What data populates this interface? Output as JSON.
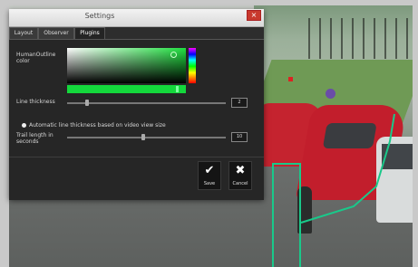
{
  "dialog": {
    "title": "Settings",
    "close_label": "×",
    "tabs": [
      {
        "label": "Layout"
      },
      {
        "label": "Observer"
      },
      {
        "label": "Plugins"
      }
    ]
  },
  "plugins": {
    "highlight_color_label": "HumanOutline color",
    "color_value": "#1fe03f",
    "line_thickness_label": "Line thickness",
    "line_thickness_value": "2",
    "auto_thickness_label": "Automatic line thickness based on video view size",
    "fade_length_label": "Trail length in seconds",
    "fade_length_value": "10",
    "save_label": "Save",
    "cancel_label": "Cancel"
  },
  "colors": {
    "accent_green": "#1fe03f",
    "zone_line": "#19c98a",
    "dialog_bg": "#262626"
  }
}
